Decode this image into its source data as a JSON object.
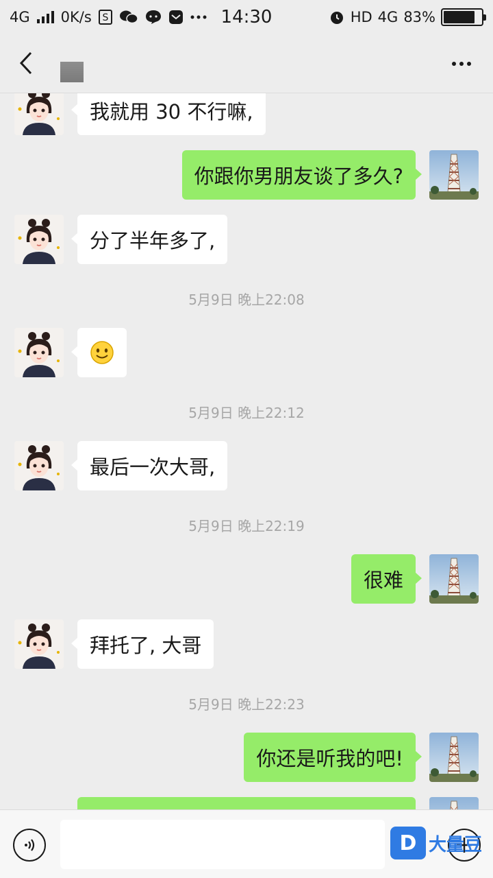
{
  "status_bar": {
    "network": "4G",
    "speed": "0K/s",
    "time": "14:30",
    "hd": "HD",
    "network_right": "4G",
    "battery": "83%",
    "battery_level": 0.83
  },
  "nav": {
    "back_icon": "chevron-left-icon",
    "more_icon": "more-dots-icon"
  },
  "messages": [
    {
      "side": "in",
      "text": "我就用 30 不行嘛,"
    },
    {
      "side": "out",
      "text": "你跟你男朋友谈了多久?"
    },
    {
      "side": "in",
      "text": "分了半年多了,"
    },
    {
      "side": "time",
      "text": "5月9日 晚上22:08"
    },
    {
      "side": "in",
      "text": "☺",
      "emoji": "smile-emoji"
    },
    {
      "side": "time",
      "text": "5月9日 晚上22:12"
    },
    {
      "side": "in",
      "text": "最后一次大哥,"
    },
    {
      "side": "time",
      "text": "5月9日 晚上22:19"
    },
    {
      "side": "out",
      "text": "很难"
    },
    {
      "side": "in",
      "text": "拜托了, 大哥"
    },
    {
      "side": "time",
      "text": "5月9日 晚上22:23"
    },
    {
      "side": "out",
      "text": "你还是听我的吧!"
    }
  ],
  "input_bar": {
    "placeholder": "",
    "watermark": "大量豆",
    "voice_icon": "voice-icon",
    "plus_icon": "plus-icon"
  },
  "colors": {
    "background": "#ededed",
    "outgoing_bubble": "#95ec69",
    "incoming_bubble": "#ffffff",
    "timestamp": "#a6a6a6"
  }
}
